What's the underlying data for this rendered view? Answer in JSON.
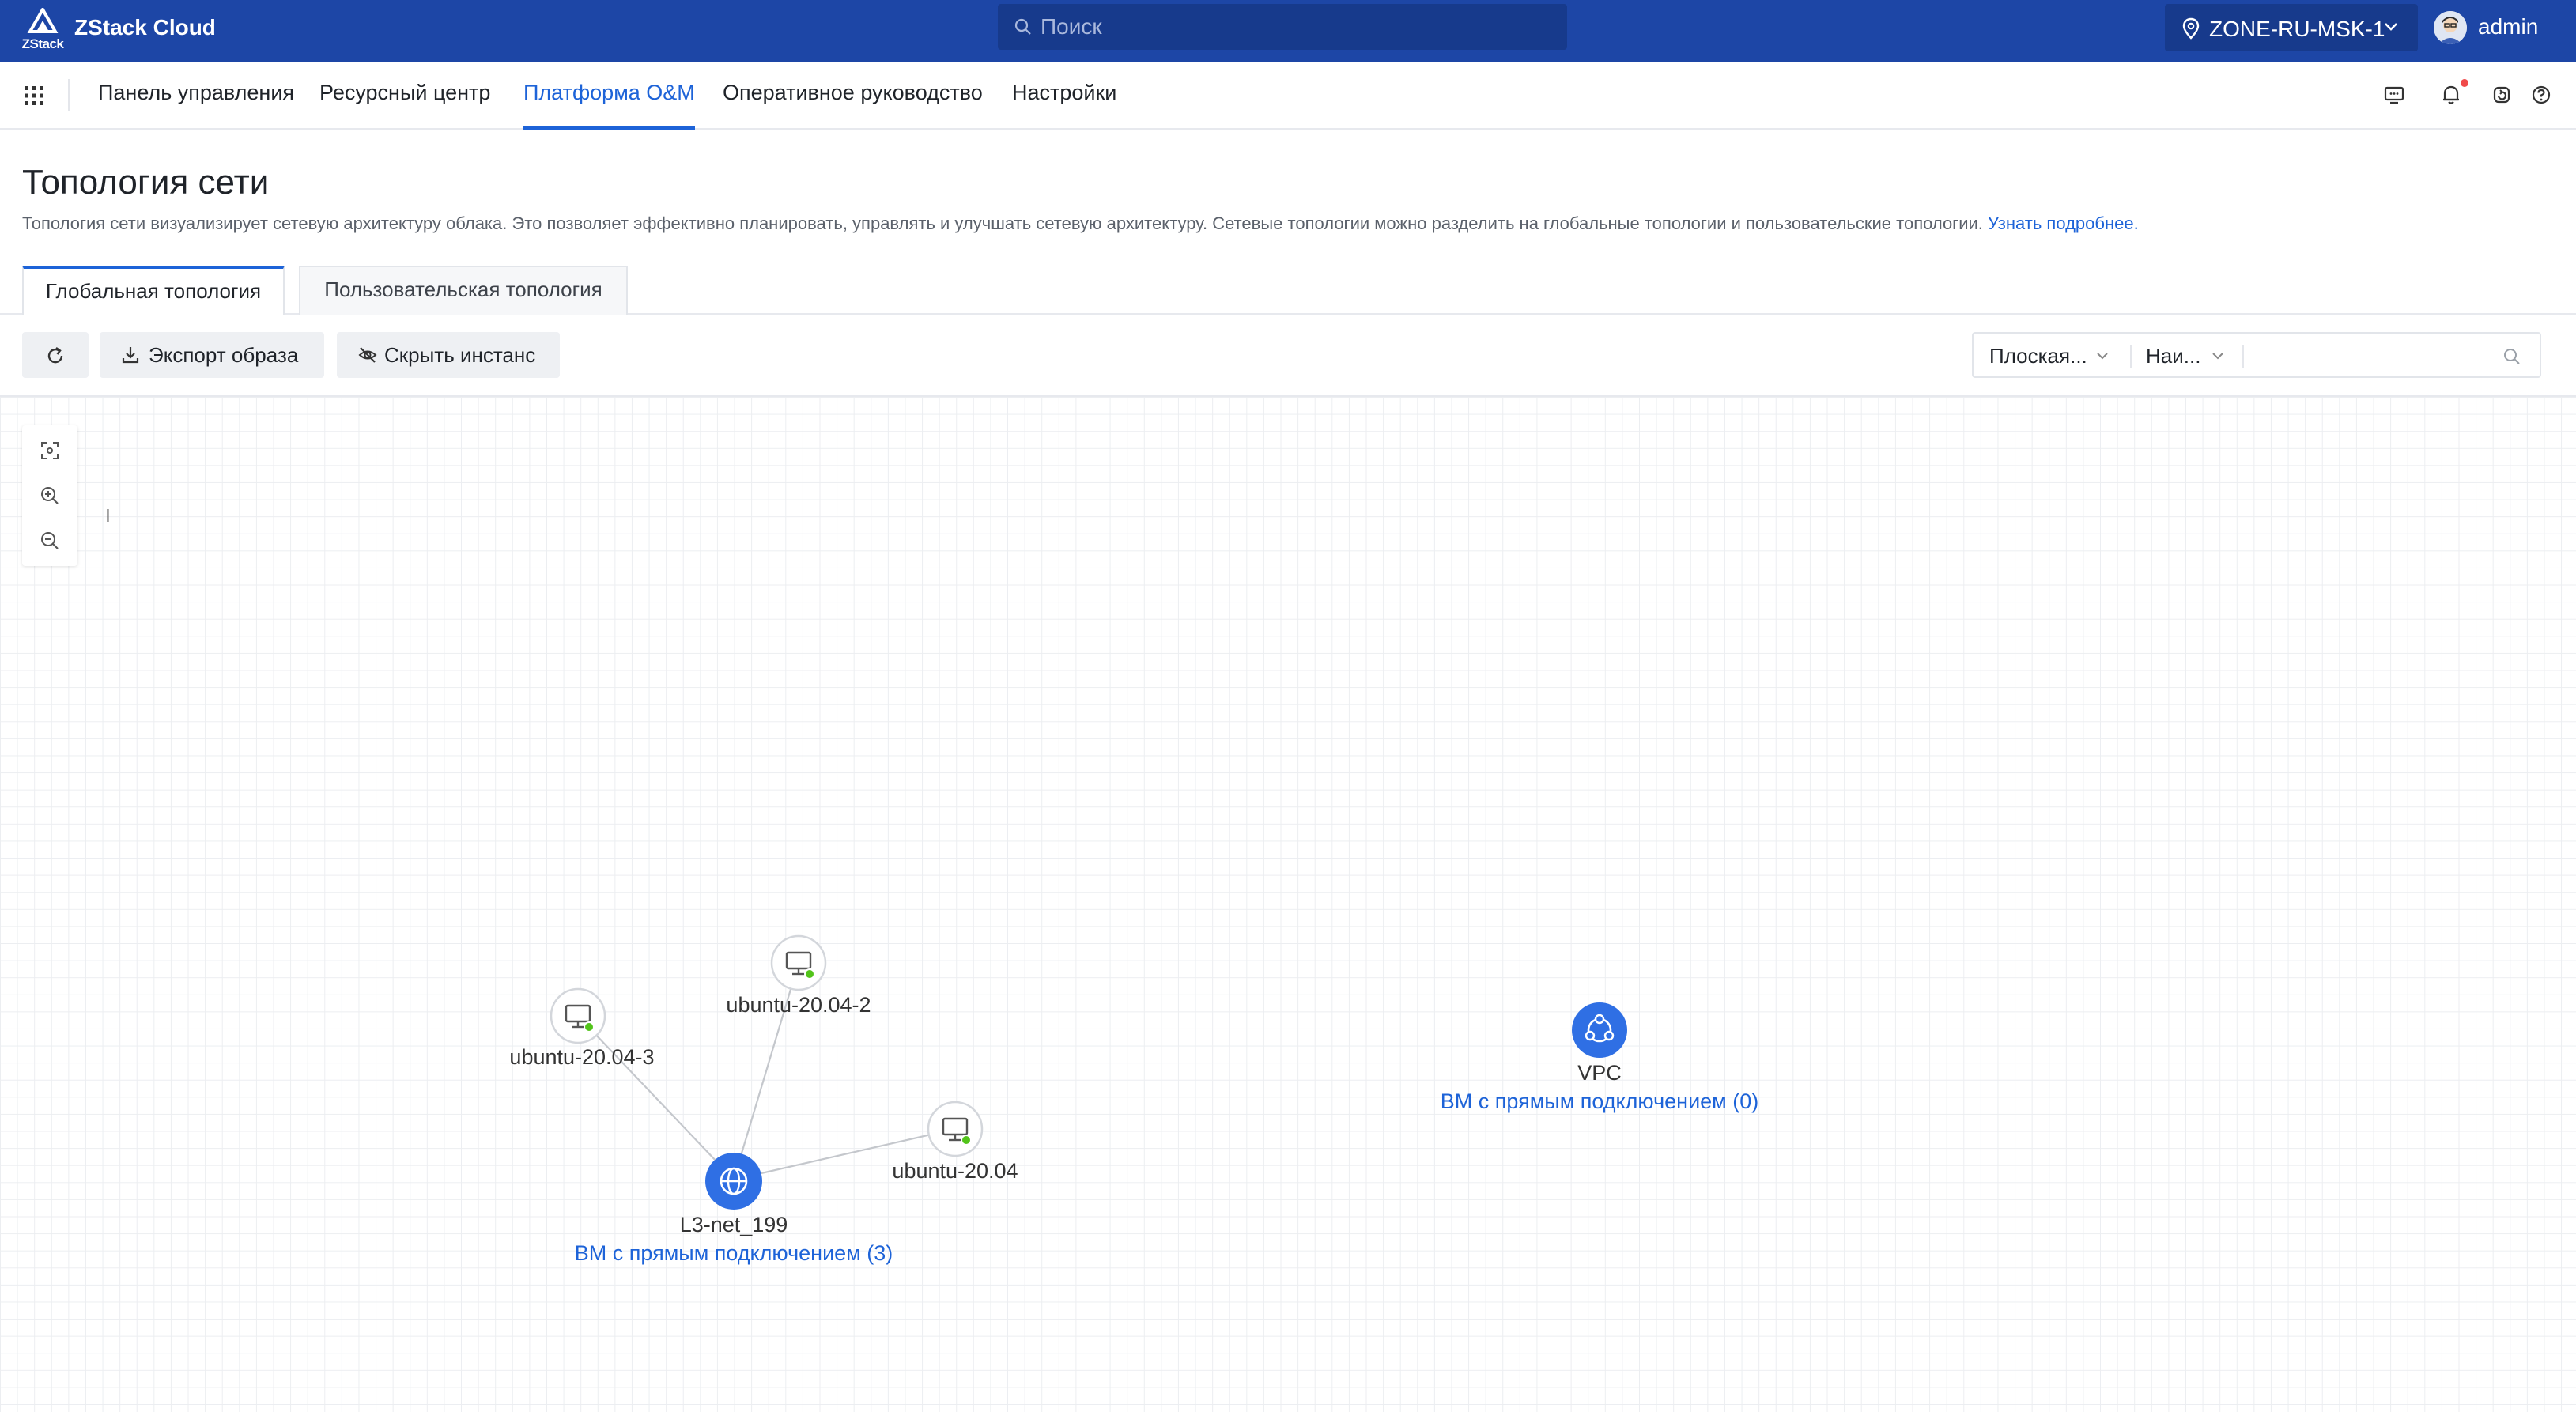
{
  "header": {
    "logo_text": "ZStack",
    "brand": "ZStack Cloud",
    "search_placeholder": "Поиск",
    "zone": "ZONE-RU-MSK-1",
    "user": "admin"
  },
  "nav": {
    "items": [
      {
        "label": "Панель управления",
        "active": false
      },
      {
        "label": "Ресурсный центр",
        "active": false
      },
      {
        "label": "Платформа O&M",
        "active": true
      },
      {
        "label": "Оперативное руководство",
        "active": false
      },
      {
        "label": "Настройки",
        "active": false
      }
    ],
    "right_icons": [
      "screen-icon",
      "bell-icon",
      "refresh-cycle-icon",
      "help-icon"
    ],
    "has_notification": true
  },
  "page": {
    "title": "Топология сети",
    "description": "Топология сети визуализирует сетевую архитектуру облака. Это позволяет эффективно планировать, управлять и улучшать сетевую архитектуру. Сетевые топологии можно разделить на глобальные топологии и пользовательские топологии.",
    "learn_more": "Узнать подробнее."
  },
  "tabs": [
    {
      "label": "Глобальная топология",
      "active": true
    },
    {
      "label": "Пользовательская топология",
      "active": false
    }
  ],
  "toolbar": {
    "export_label": "Экспорт образа",
    "hide_label": "Скрыть инстанс",
    "filter_layout": "Плоская...",
    "filter_field": "Наи...",
    "filter_value": ""
  },
  "canvas": {
    "stray_text": "l",
    "nodes": {
      "vm3": {
        "label": "ubuntu-20.04-3",
        "status": "running"
      },
      "vm2": {
        "label": "ubuntu-20.04-2",
        "status": "running"
      },
      "vm1": {
        "label": "ubuntu-20.04",
        "status": "running"
      },
      "l3": {
        "label": "L3-net_199",
        "sub": "ВМ с прямым подключением (3)"
      },
      "vpc": {
        "label": "VPC",
        "sub": "ВМ с прямым подключением (0)"
      }
    }
  },
  "colors": {
    "header_bg": "#1d46a6",
    "accent": "#1d63d8",
    "status_running": "#52c41a"
  }
}
